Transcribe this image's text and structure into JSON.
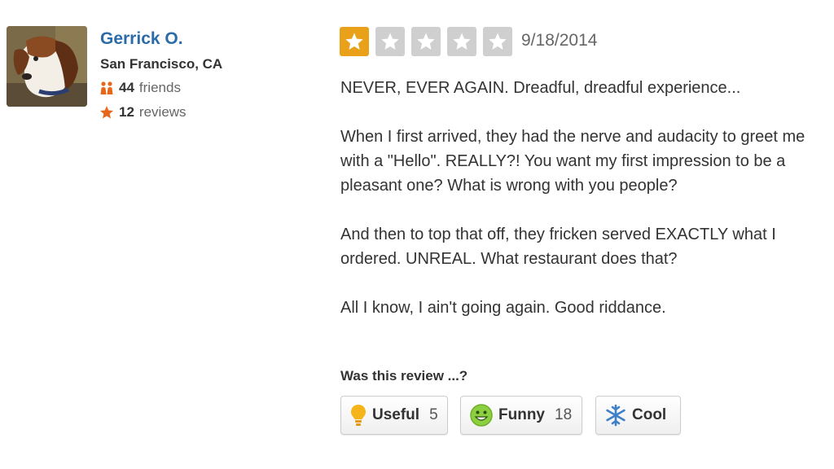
{
  "user": {
    "name": "Gerrick O.",
    "location": "San Francisco, CA",
    "friends_count": "44",
    "friends_label": "friends",
    "reviews_count": "12",
    "reviews_label": "reviews"
  },
  "review": {
    "rating": 1,
    "max_rating": 5,
    "date": "9/18/2014",
    "paragraphs": [
      "NEVER, EVER AGAIN.  Dreadful, dreadful experience...",
      "When I first arrived, they had the nerve and audacity to greet me with a \"Hello\".  REALLY?!  You want my first impression to be a pleasant one? What is wrong with you people?",
      "And then to top that off, they fricken served EXACTLY what I ordered.  UNREAL.  What restaurant does that?",
      "All I know, I ain't going again.  Good riddance."
    ]
  },
  "votes": {
    "prompt": "Was this review ...?",
    "useful": {
      "label": "Useful",
      "count": "5",
      "icon": "lightbulb-icon"
    },
    "funny": {
      "label": "Funny",
      "count": "18",
      "icon": "smiley-icon"
    },
    "cool": {
      "label": "Cool",
      "icon": "snowflake-icon"
    }
  },
  "colors": {
    "name_link": "#2b6ba8",
    "star_active": "#e9a11a",
    "star_inactive": "#cfcfcf",
    "icon_orange": "#e8661a"
  }
}
